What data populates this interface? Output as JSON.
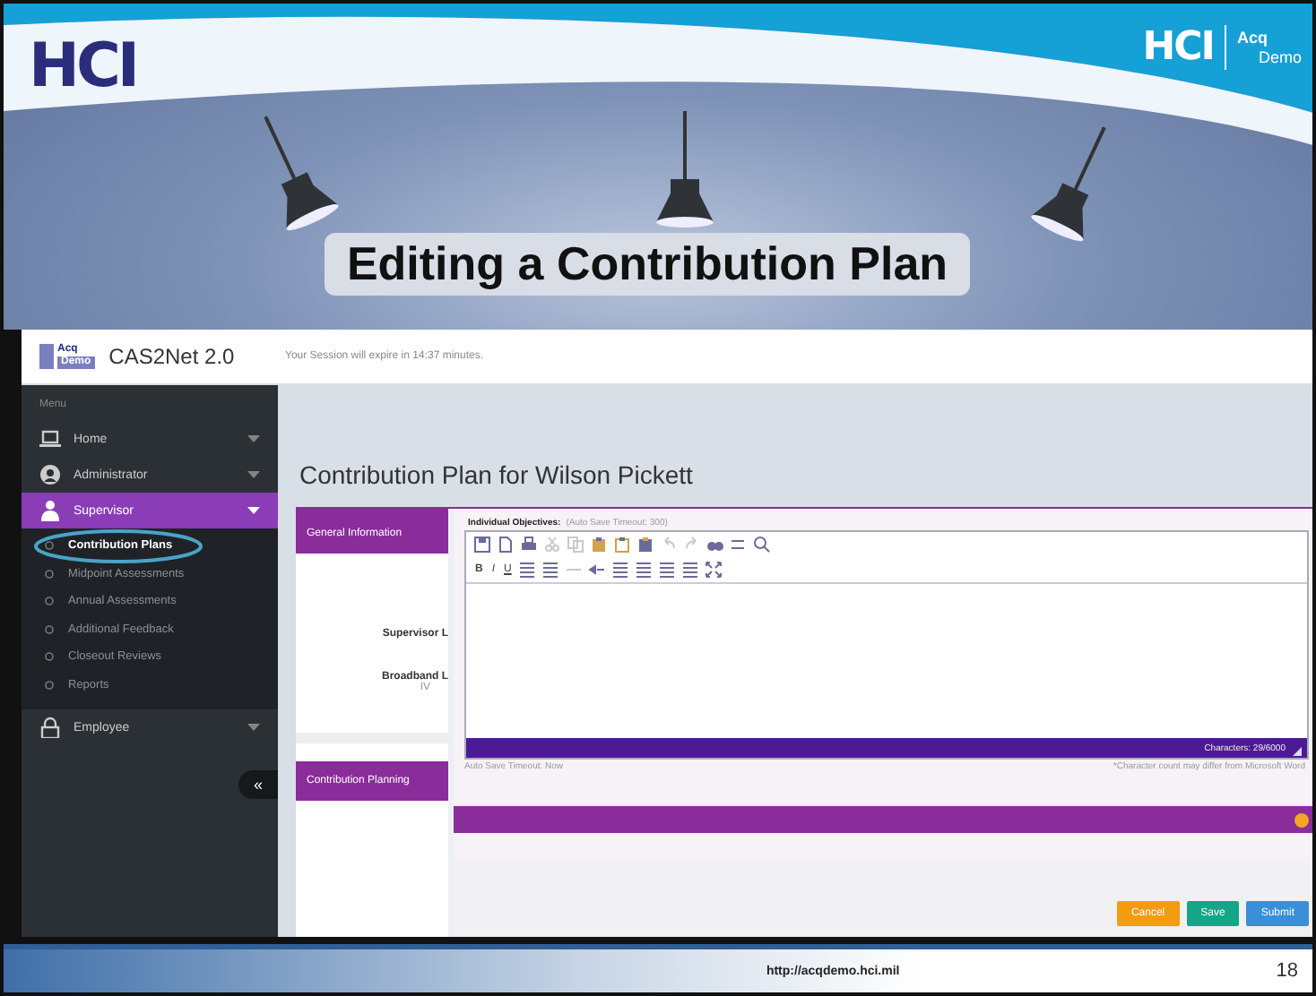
{
  "slide": {
    "logo": "HCI",
    "brand_logo": {
      "mark": "HCI",
      "acq": "Acq",
      "demo": "Demo"
    },
    "title": "Editing a Contribution Plan",
    "footer_url": "http://acqdemo.hci.mil",
    "page_number": "18"
  },
  "app": {
    "logo": {
      "acq": "Acq",
      "demo": "Demo"
    },
    "name": "CAS2Net 2.0",
    "session_notice": "Your Session will expire in 14:37 minutes."
  },
  "sidebar": {
    "heading": "Menu",
    "collapse": "«",
    "items": [
      {
        "label": "Home",
        "selected": false,
        "expanded": false
      },
      {
        "label": "Administrator",
        "selected": false,
        "expanded": false
      },
      {
        "label": "Supervisor",
        "selected": true,
        "expanded": true,
        "children": [
          {
            "label": "Contribution Plans",
            "selected": true,
            "circled": true
          },
          {
            "label": "Midpoint Assessments",
            "selected": false,
            "circled": false
          },
          {
            "label": "Annual Assessments",
            "selected": false,
            "circled": false
          },
          {
            "label": "Additional Feedback",
            "selected": false,
            "circled": false
          },
          {
            "label": "Closeout Reviews",
            "selected": false,
            "circled": false
          },
          {
            "label": "Reports",
            "selected": false,
            "circled": false
          }
        ]
      },
      {
        "label": "Employee",
        "selected": false,
        "expanded": false
      }
    ]
  },
  "page": {
    "title": "Contribution Plan for Wilson Pickett",
    "sections": [
      {
        "label": "General Information",
        "fields": [
          {
            "label": "Supervisor L"
          },
          {
            "label": "Broadband L",
            "value": "IV"
          }
        ]
      },
      {
        "label": "Contribution Planning"
      }
    ]
  },
  "editor": {
    "label": "Individual Objectives:",
    "hint": "(Auto Save Timeout: 300)",
    "format_buttons": [
      "B",
      "I",
      "U"
    ],
    "character_count": "Characters: 29/6000",
    "autosave_status": "Auto Save Timeout: Now",
    "note": "*Character count may differ from Microsoft Word"
  },
  "buttons": [
    {
      "label": "Cancel",
      "kind": "warning"
    },
    {
      "label": "Save",
      "kind": "success"
    },
    {
      "label": "Submit",
      "kind": "primary"
    }
  ]
}
